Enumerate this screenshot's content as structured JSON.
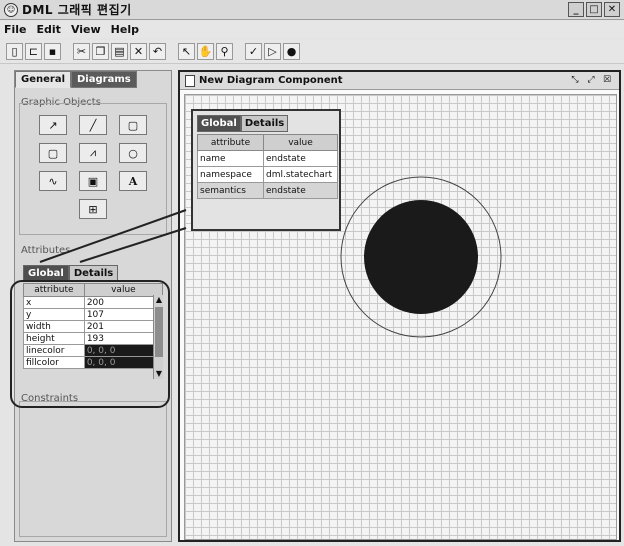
{
  "window": {
    "title": "DML 그래픽 편집기",
    "controls": [
      "minimize-icon",
      "maximize-icon",
      "close-icon"
    ]
  },
  "menu": {
    "items": [
      "File",
      "Edit",
      "View",
      "Help"
    ]
  },
  "toolbar": {
    "icons": [
      "new-icon",
      "open-icon",
      "save-icon",
      "cut-icon",
      "copy-icon",
      "paste-icon",
      "delete-icon",
      "undo-icon",
      "pointer-icon",
      "hand-icon",
      "zoom-icon",
      "check-icon",
      "play-icon",
      "record-icon"
    ]
  },
  "left_panel": {
    "tabs": [
      "General",
      "Diagrams"
    ],
    "graphic_objects_label": "Graphic Objects",
    "objects": [
      {
        "name": "arrow-tool-icon",
        "glyph": "↗"
      },
      {
        "name": "line-tool-icon",
        "glyph": "╱"
      },
      {
        "name": "rectangle-tool-icon",
        "glyph": "▢"
      },
      {
        "name": "rounded-rect-tool-icon",
        "glyph": "▢"
      },
      {
        "name": "polyline-tool-icon",
        "glyph": "⩘"
      },
      {
        "name": "ellipse-tool-icon",
        "glyph": "○"
      },
      {
        "name": "curve-tool-icon",
        "glyph": "∿"
      },
      {
        "name": "image-tool-icon",
        "glyph": "▣"
      },
      {
        "name": "text-tool-icon",
        "glyph": "A"
      },
      {
        "name": "connector-tool-icon",
        "glyph": "⊞"
      }
    ],
    "attributes_label": "Attributes",
    "attr_tabs": [
      "Global",
      "Details"
    ],
    "attr_headers": [
      "attribute",
      "value"
    ],
    "attr_rows": [
      {
        "attribute": "x",
        "value": "200"
      },
      {
        "attribute": "y",
        "value": "107"
      },
      {
        "attribute": "width",
        "value": "201"
      },
      {
        "attribute": "height",
        "value": "193"
      },
      {
        "attribute": "linecolor",
        "value": "0, 0, 0",
        "dark": true
      },
      {
        "attribute": "fillcolor",
        "value": "0, 0, 0",
        "dark": true
      }
    ],
    "constraints_label": "Constraints"
  },
  "diagram": {
    "title": "New Diagram Component",
    "global_panel": {
      "tabs": [
        "Global",
        "Details"
      ],
      "headers": [
        "attribute",
        "value"
      ],
      "rows": [
        {
          "attribute": "name",
          "value": "endstate"
        },
        {
          "attribute": "namespace",
          "value": "dml.statechart"
        },
        {
          "attribute": "semantics",
          "value": "endstate"
        }
      ]
    }
  },
  "colors": {
    "grid": "#c9c9c9",
    "end_state_fill": "#1a1a1a",
    "end_state_ring": "#444444"
  }
}
